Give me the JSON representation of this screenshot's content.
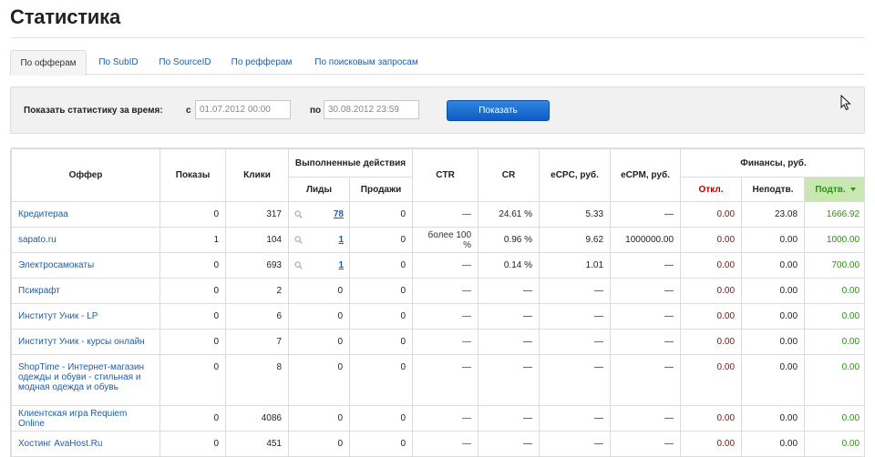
{
  "page": {
    "title": "Статистика"
  },
  "tabs": [
    {
      "label": "По офферам",
      "active": true
    },
    {
      "label": "По SubID",
      "active": false
    },
    {
      "label": "По SourceID",
      "active": false
    },
    {
      "label": "По рефферам",
      "active": false
    },
    {
      "label": "По поисковым запросам",
      "active": false
    }
  ],
  "filter": {
    "label": "Показать статистику за время:",
    "from_label": "с",
    "from_value": "01.07.2012 00:00",
    "to_label": "по",
    "to_value": "30.08.2012 23:59",
    "button": "Показать"
  },
  "table": {
    "headers": {
      "offer": "Оффер",
      "shows": "Показы",
      "clicks": "Клики",
      "actions": "Выполненные действия",
      "leads": "Лиды",
      "sales": "Продажи",
      "ctr": "CTR",
      "cr": "CR",
      "ecpc": "eCPC, руб.",
      "ecpm": "eCPM, руб.",
      "finance": "Финансы, руб.",
      "rejected": "Откл.",
      "unconfirmed": "Неподтв.",
      "confirmed": "Подтв."
    },
    "rows": [
      {
        "offer": "Кредитераа",
        "shows": "0",
        "clicks": "317",
        "leads": "78",
        "leads_link": true,
        "sales": "0",
        "ctr": "—",
        "cr": "24.61 %",
        "ecpc": "5.33",
        "ecpm": "—",
        "rejected": "0.00",
        "unconfirmed": "23.08",
        "confirmed": "1666.92"
      },
      {
        "offer": "sapato.ru",
        "shows": "1",
        "clicks": "104",
        "leads": "1",
        "leads_link": true,
        "sales": "0",
        "ctr": "более 100 %",
        "cr": "0.96 %",
        "ecpc": "9.62",
        "ecpm": "1000000.00",
        "rejected": "0.00",
        "unconfirmed": "0.00",
        "confirmed": "1000.00"
      },
      {
        "offer": "Электросамокаты",
        "shows": "0",
        "clicks": "693",
        "leads": "1",
        "leads_link": true,
        "sales": "0",
        "ctr": "—",
        "cr": "0.14 %",
        "ecpc": "1.01",
        "ecpm": "—",
        "rejected": "0.00",
        "unconfirmed": "0.00",
        "confirmed": "700.00"
      },
      {
        "offer": "Псикрафт",
        "shows": "0",
        "clicks": "2",
        "leads": "0",
        "leads_link": false,
        "sales": "0",
        "ctr": "—",
        "cr": "—",
        "ecpc": "—",
        "ecpm": "—",
        "rejected": "0.00",
        "unconfirmed": "0.00",
        "confirmed": "0.00"
      },
      {
        "offer": "Институт Уник - LP",
        "shows": "0",
        "clicks": "6",
        "leads": "0",
        "leads_link": false,
        "sales": "0",
        "ctr": "—",
        "cr": "—",
        "ecpc": "—",
        "ecpm": "—",
        "rejected": "0.00",
        "unconfirmed": "0.00",
        "confirmed": "0.00"
      },
      {
        "offer": "Институт Уник - курсы онлайн",
        "shows": "0",
        "clicks": "7",
        "leads": "0",
        "leads_link": false,
        "sales": "0",
        "ctr": "—",
        "cr": "—",
        "ecpc": "—",
        "ecpm": "—",
        "rejected": "0.00",
        "unconfirmed": "0.00",
        "confirmed": "0.00"
      },
      {
        "offer": "ShopTime - Интернет-магазин одежды и обуви - стильная и модная одежда и обувь",
        "shows": "0",
        "clicks": "8",
        "leads": "0",
        "leads_link": false,
        "sales": "0",
        "ctr": "—",
        "cr": "—",
        "ecpc": "—",
        "ecpm": "—",
        "rejected": "0.00",
        "unconfirmed": "0.00",
        "confirmed": "0.00",
        "tall": true
      },
      {
        "offer": "Клиентская игра Requiem Online",
        "shows": "0",
        "clicks": "4086",
        "leads": "0",
        "leads_link": false,
        "sales": "0",
        "ctr": "—",
        "cr": "—",
        "ecpc": "—",
        "ecpm": "—",
        "rejected": "0.00",
        "unconfirmed": "0.00",
        "confirmed": "0.00"
      },
      {
        "offer": "Хостинг AvaHost.Ru",
        "shows": "0",
        "clicks": "451",
        "leads": "0",
        "leads_link": false,
        "sales": "0",
        "ctr": "—",
        "cr": "—",
        "ecpc": "—",
        "ecpm": "—",
        "rejected": "0.00",
        "unconfirmed": "0.00",
        "confirmed": "0.00"
      }
    ]
  },
  "colors": {
    "link": "#1a5faf",
    "rejected": "#b00000",
    "confirmed": "#2e8f13",
    "confirmed_header_bg": "#c8e7b3",
    "button": "#1a6fd6"
  }
}
